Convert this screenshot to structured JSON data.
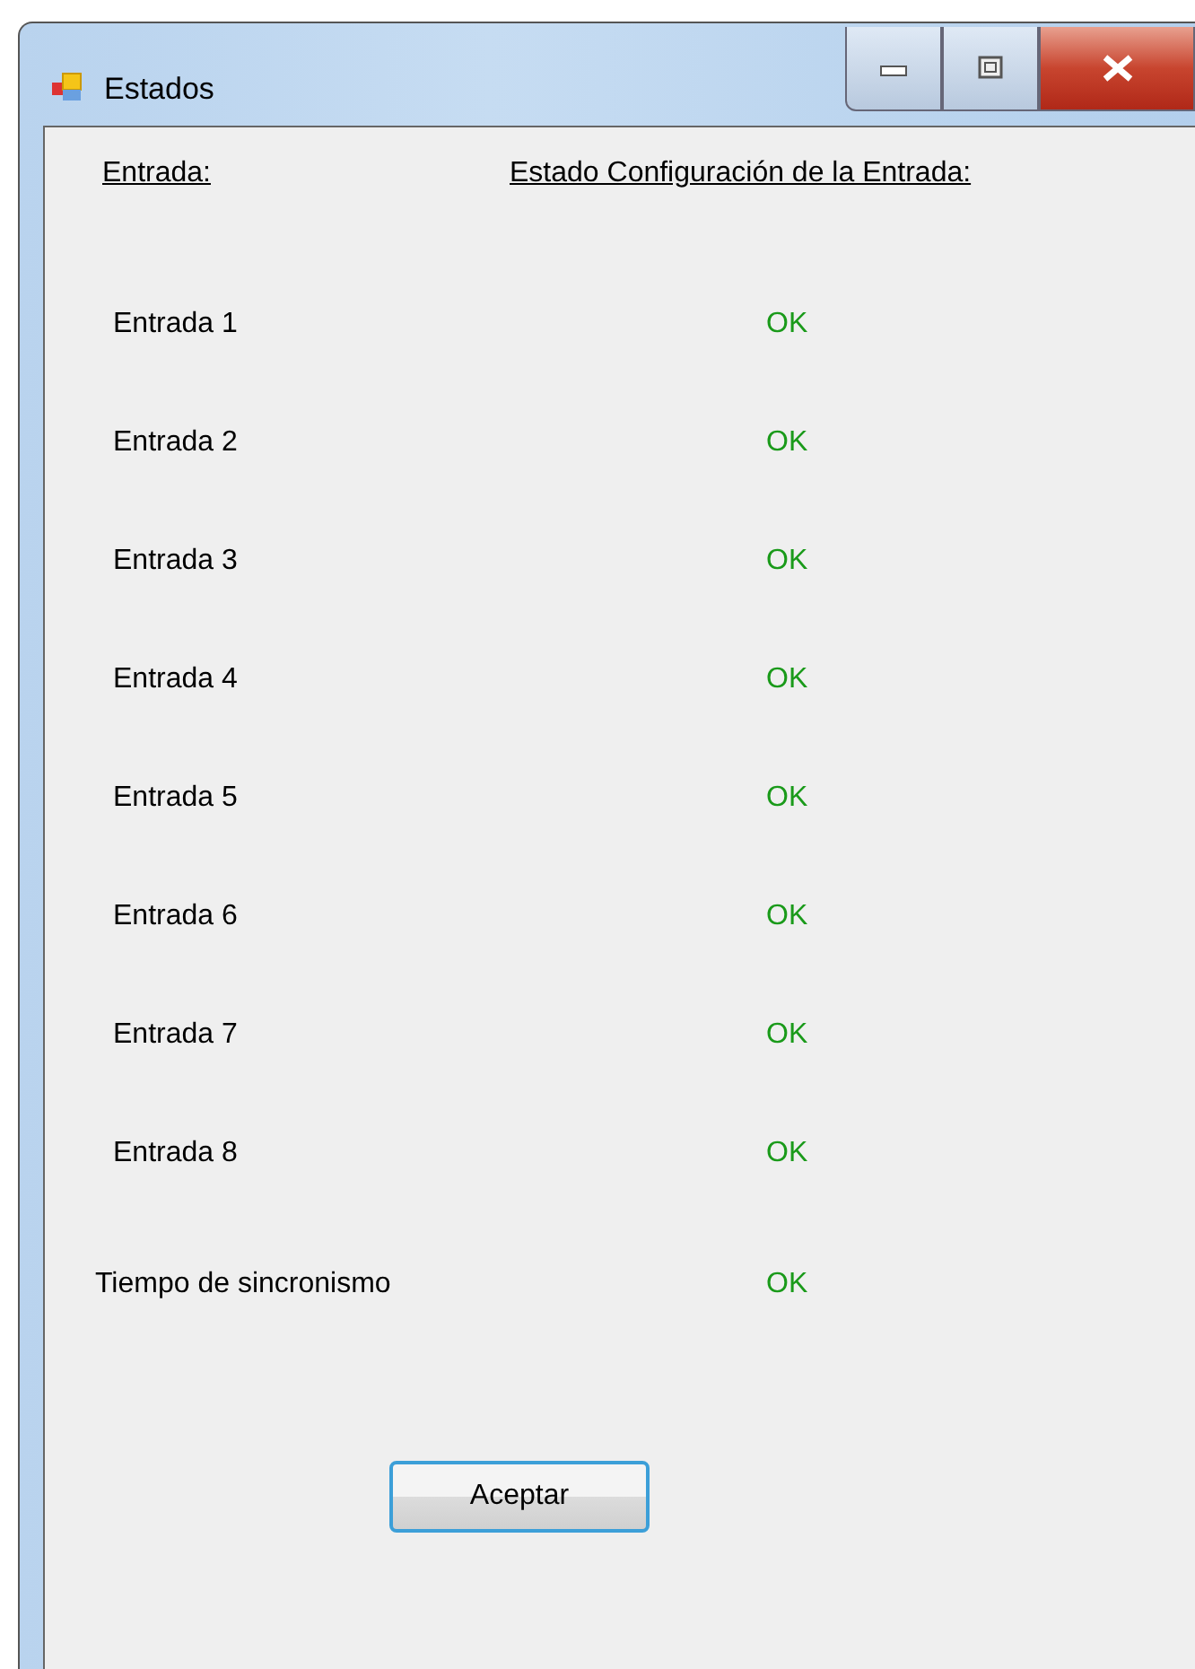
{
  "window": {
    "title": "Estados"
  },
  "headers": [
    "Entrada:",
    "Estado Configuración de la Entrada:"
  ],
  "rows": [
    {
      "label": "Entrada 1",
      "status": "OK"
    },
    {
      "label": "Entrada 2",
      "status": "OK"
    },
    {
      "label": "Entrada 3",
      "status": "OK"
    },
    {
      "label": "Entrada 4",
      "status": "OK"
    },
    {
      "label": "Entrada 5",
      "status": "OK"
    },
    {
      "label": "Entrada 6",
      "status": "OK"
    },
    {
      "label": "Entrada 7",
      "status": "OK"
    },
    {
      "label": "Entrada 8",
      "status": "OK"
    },
    {
      "label": "Tiempo de sincronismo",
      "status": "OK"
    }
  ],
  "buttons": [
    "Aceptar"
  ]
}
